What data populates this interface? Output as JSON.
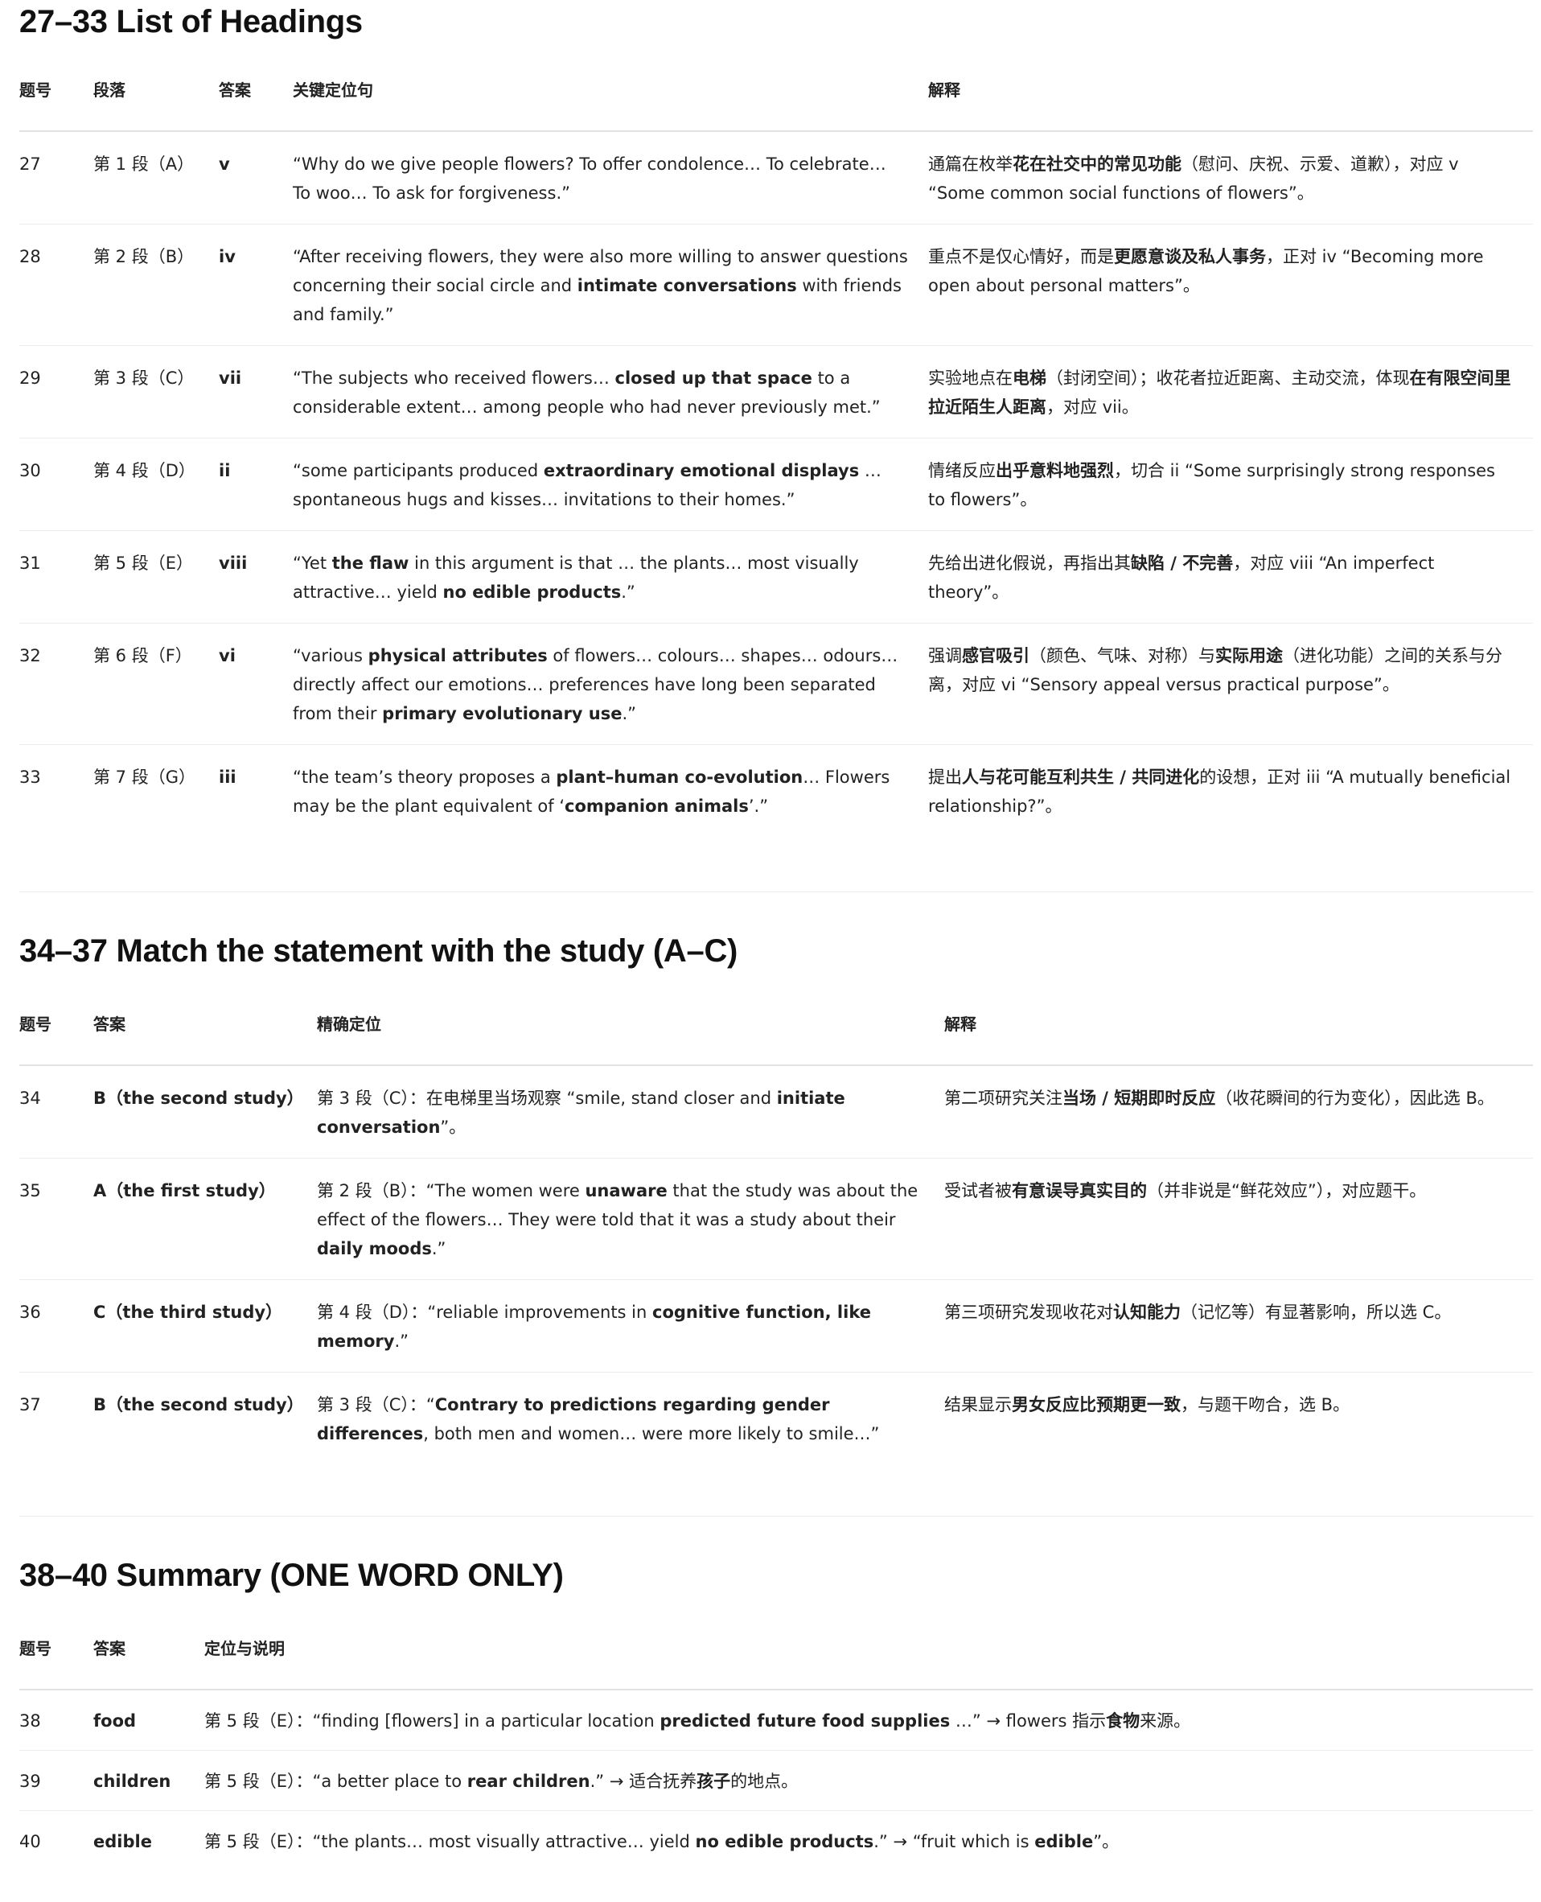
{
  "section1": {
    "title": "27–33 List of Headings",
    "headers": [
      "题号",
      "段落",
      "答案",
      "关键定位句",
      "解释"
    ],
    "rows": [
      {
        "num": "27",
        "para": "第 1 段（A）",
        "ans": "v",
        "quote": "“Why do we give people flowers? To offer condolence… To celebrate… To woo… To ask for forgiveness.”",
        "expl": "通篇在枚举<b>花在社交中的常见功能</b>（慰问、庆祝、示爱、道歉），对应 v “Some common social functions of flowers”。"
      },
      {
        "num": "28",
        "para": "第 2 段（B）",
        "ans": "iv",
        "quote": "“After receiving flowers, they were also more willing to answer questions concerning their social circle and <b>intimate conversations</b> with friends and family.”",
        "expl": "重点不是仅心情好，而是<b>更愿意谈及私人事务</b>，正对 iv “Becoming more open about personal matters”。"
      },
      {
        "num": "29",
        "para": "第 3 段（C）",
        "ans": "vii",
        "quote": "“The subjects who received flowers… <b>closed up that space</b> to a considerable extent… among people who had never previously met.”",
        "expl": "实验地点在<b>电梯</b>（封闭空间）；收花者拉近距离、主动交流，体现<b>在有限空间里拉近陌生人距离</b>，对应 vii。"
      },
      {
        "num": "30",
        "para": "第 4 段（D）",
        "ans": "ii",
        "quote": "“some participants produced <b>extraordinary emotional displays</b> … spontaneous hugs and kisses… invitations to their homes.”",
        "expl": "情绪反应<b>出乎意料地强烈</b>，切合 ii “Some surprisingly strong responses to flowers”。"
      },
      {
        "num": "31",
        "para": "第 5 段（E）",
        "ans": "viii",
        "quote": "“Yet <b>the flaw</b> in this argument is that … the plants… most visually attractive… yield <b>no edible products</b>.”",
        "expl": "先给出进化假说，再指出其<b>缺陷 / 不完善</b>，对应 viii “An imperfect theory”。"
      },
      {
        "num": "32",
        "para": "第 6 段（F）",
        "ans": "vi",
        "quote": "“various <b>physical attributes</b> of flowers… colours… shapes… odours… directly affect our emotions… preferences have long been separated from their <b>primary evolutionary use</b>.”",
        "expl": "强调<b>感官吸引</b>（颜色、气味、对称）与<b>实际用途</b>（进化功能）之间的关系与分离，对应 vi “Sensory appeal versus practical purpose”。"
      },
      {
        "num": "33",
        "para": "第 7 段（G）",
        "ans": "iii",
        "quote": "“the team’s theory proposes a <b>plant–human co-evolution</b>… Flowers may be the plant equivalent of ‘<b>companion animals</b>’.”",
        "expl": "提出<b>人与花可能互利共生 / 共同进化</b>的设想，正对 iii “A mutually beneficial relationship?”。"
      }
    ]
  },
  "section2": {
    "title": "34–37 Match the statement with the study (A–C)",
    "headers": [
      "题号",
      "答案",
      "精确定位",
      "解释"
    ],
    "rows": [
      {
        "num": "34",
        "ans": "B（the second study）",
        "loc": "第 3 段（C）：在电梯里当场观察 “smile, stand closer and <b>initiate conversation</b>”。",
        "expl": "第二项研究关注<b>当场 / 短期即时反应</b>（收花瞬间的行为变化），因此选 B。"
      },
      {
        "num": "35",
        "ans": "A（the first study）",
        "loc": "第 2 段（B）：“The women were <b>unaware</b> that the study was about the effect of the flowers… They were told that it was a study about their <b>daily moods</b>.”",
        "expl": "受试者被<b>有意误导真实目的</b>（并非说是“鲜花效应”），对应题干。"
      },
      {
        "num": "36",
        "ans": "C（the third study）",
        "loc": "第 4 段（D）：“reliable improvements in <b>cognitive function, like memory</b>.”",
        "expl": "第三项研究发现收花对<b>认知能力</b>（记忆等）有显著影响，所以选 C。"
      },
      {
        "num": "37",
        "ans": "B（the second study）",
        "loc": "第 3 段（C）：“<b>Contrary to predictions regarding gender differences</b>, both men and women… were more likely to smile…”",
        "expl": "结果显示<b>男女反应比预期更一致</b>，与题干吻合，选 B。"
      }
    ]
  },
  "section3": {
    "title": "38–40 Summary (ONE WORD ONLY)",
    "headers": [
      "题号",
      "答案",
      "定位与说明"
    ],
    "rows": [
      {
        "num": "38",
        "ans": "food",
        "loc": "第 5 段（E）：“finding [flowers] in a particular location <b>predicted future food supplies</b> …” → flowers 指示<b>食物</b>来源。"
      },
      {
        "num": "39",
        "ans": "children",
        "loc": "第 5 段（E）：“a better place to <b>rear children</b>.” → 适合抚养<b>孩子</b>的地点。"
      },
      {
        "num": "40",
        "ans": "edible",
        "loc": "第 5 段（E）：“the plants… most visually attractive… yield <b>no edible products</b>.” → “fruit which is <b>edible</b>”。"
      }
    ]
  }
}
